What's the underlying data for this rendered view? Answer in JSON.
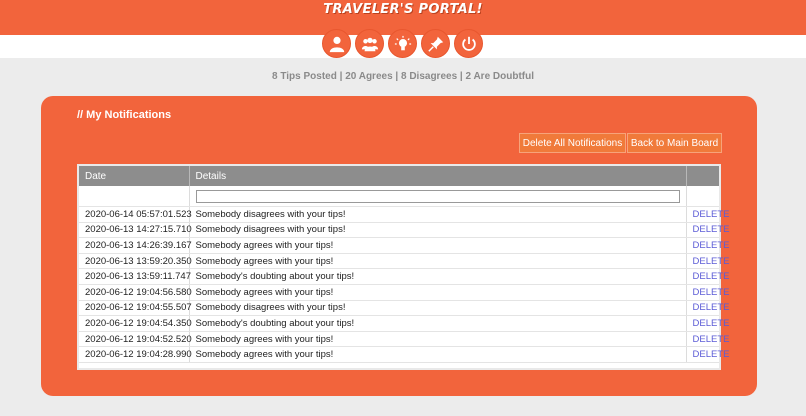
{
  "header": {
    "title": "TRAVELER'S PORTAL!"
  },
  "nav": {
    "icons": [
      "user-icon",
      "group-icon",
      "lightbulb-icon",
      "pin-icon",
      "power-icon"
    ]
  },
  "stats": {
    "text": "8 Tips Posted | 20 Agrees | 8 Disagrees | 2 Are Doubtful"
  },
  "panel": {
    "title": "// My Notifications",
    "delete_all_label": "Delete All Notifications",
    "back_label": "Back to Main Board"
  },
  "table": {
    "headers": {
      "date": "Date",
      "details": "Details"
    },
    "filter_value": "",
    "delete_label": "DELETE",
    "rows": [
      {
        "date": "2020-06-14 05:57:01.523",
        "details": "Somebody disagrees with your tips!"
      },
      {
        "date": "2020-06-13 14:27:15.710",
        "details": "Somebody disagrees with your tips!"
      },
      {
        "date": "2020-06-13 14:26:39.167",
        "details": "Somebody agrees with your tips!"
      },
      {
        "date": "2020-06-13 13:59:20.350",
        "details": "Somebody agrees with your tips!"
      },
      {
        "date": "2020-06-13 13:59:11.747",
        "details": "Somebody's doubting about your tips!"
      },
      {
        "date": "2020-06-12 19:04:56.580",
        "details": "Somebody agrees with your tips!"
      },
      {
        "date": "2020-06-12 19:04:55.507",
        "details": "Somebody disagrees with your tips!"
      },
      {
        "date": "2020-06-12 19:04:54.350",
        "details": "Somebody's doubting about your tips!"
      },
      {
        "date": "2020-06-12 19:04:52.520",
        "details": "Somebody agrees with your tips!"
      },
      {
        "date": "2020-06-12 19:04:28.990",
        "details": "Somebody agrees with your tips!"
      }
    ]
  },
  "colors": {
    "accent": "#f2643c",
    "header_gray": "#8d8d8d",
    "link": "#5b5bd6"
  }
}
